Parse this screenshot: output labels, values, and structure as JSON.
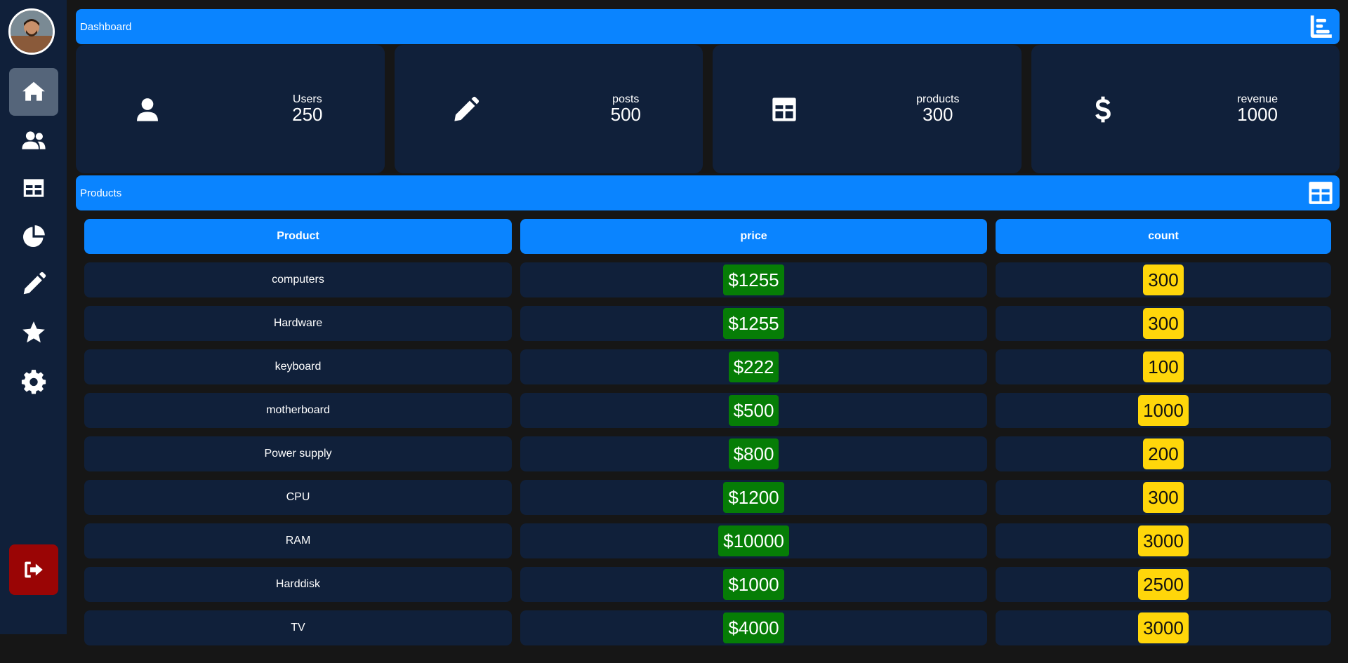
{
  "sidebar": {
    "items": [
      {
        "name": "home-icon",
        "active": true
      },
      {
        "name": "users-icon",
        "active": false
      },
      {
        "name": "table-icon",
        "active": false
      },
      {
        "name": "pie-chart-icon",
        "active": false
      },
      {
        "name": "pencil-icon",
        "active": false
      },
      {
        "name": "star-icon",
        "active": false
      },
      {
        "name": "gear-icon",
        "active": false
      }
    ],
    "logout_icon": "logout-icon"
  },
  "dashboard": {
    "title": "Dashboard",
    "icon": "chart-bar-icon"
  },
  "stats": [
    {
      "label": "Users",
      "value": "250",
      "icon": "user-icon"
    },
    {
      "label": "posts",
      "value": "500",
      "icon": "pencil-icon"
    },
    {
      "label": "products",
      "value": "300",
      "icon": "table-icon"
    },
    {
      "label": "revenue",
      "value": "1000",
      "icon": "dollar-icon"
    }
  ],
  "products": {
    "title": "Products",
    "icon": "table-icon",
    "columns": [
      "Product",
      "price",
      "count"
    ],
    "rows": [
      {
        "product": "computers",
        "price": "$1255",
        "count": "300"
      },
      {
        "product": "Hardware",
        "price": "$1255",
        "count": "300"
      },
      {
        "product": "keyboard",
        "price": "$222",
        "count": "100"
      },
      {
        "product": "motherboard",
        "price": "$500",
        "count": "1000"
      },
      {
        "product": "Power supply",
        "price": "$800",
        "count": "200"
      },
      {
        "product": "CPU",
        "price": "$1200",
        "count": "300"
      },
      {
        "product": "RAM",
        "price": "$10000",
        "count": "3000"
      },
      {
        "product": "Harddisk",
        "price": "$1000",
        "count": "2500"
      },
      {
        "product": "TV",
        "price": "$4000",
        "count": "3000"
      }
    ]
  },
  "colors": {
    "accent": "#0a84ff",
    "panel": "#10203a",
    "background": "#161616",
    "price_badge": "#067d06",
    "count_badge": "#ffd60a",
    "logout": "#9a0505"
  }
}
